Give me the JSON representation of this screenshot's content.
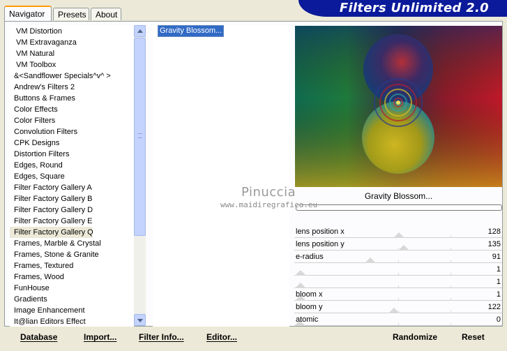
{
  "tabs": [
    "Navigator",
    "Presets",
    "About"
  ],
  "app_title": "Filters Unlimited 2.0",
  "categories": [
    {
      "label": "VM Distortion",
      "indent": true
    },
    {
      "label": "VM Extravaganza",
      "indent": true
    },
    {
      "label": "VM Natural",
      "indent": true
    },
    {
      "label": "VM Toolbox",
      "indent": true
    },
    {
      "label": "&<Sandflower Specials^v^ >",
      "indent": false
    },
    {
      "label": "Andrew's Filters 2",
      "indent": false
    },
    {
      "label": "Buttons & Frames",
      "indent": false
    },
    {
      "label": "Color Effects",
      "indent": false
    },
    {
      "label": "Color Filters",
      "indent": false
    },
    {
      "label": "Convolution Filters",
      "indent": false
    },
    {
      "label": "CPK Designs",
      "indent": false
    },
    {
      "label": "Distortion Filters",
      "indent": false
    },
    {
      "label": "Edges, Round",
      "indent": false
    },
    {
      "label": "Edges, Square",
      "indent": false
    },
    {
      "label": "Filter Factory Gallery A",
      "indent": false
    },
    {
      "label": "Filter Factory Gallery B",
      "indent": false
    },
    {
      "label": "Filter Factory Gallery D",
      "indent": false
    },
    {
      "label": "Filter Factory Gallery E",
      "indent": false
    },
    {
      "label": "Filter Factory Gallery Q",
      "indent": false,
      "selected": true
    },
    {
      "label": "Frames, Marble & Crystal",
      "indent": false
    },
    {
      "label": "Frames, Stone & Granite",
      "indent": false
    },
    {
      "label": "Frames, Textured",
      "indent": false
    },
    {
      "label": "Frames, Wood",
      "indent": false
    },
    {
      "label": "FunHouse",
      "indent": false
    },
    {
      "label": "Gradients",
      "indent": false
    },
    {
      "label": "Image Enhancement",
      "indent": false
    },
    {
      "label": "It@lian Editors Effect",
      "indent": false
    }
  ],
  "filters": [
    "Gravity Blossom..."
  ],
  "preview_name": "Gravity Blossom...",
  "sliders": [
    {
      "label": "lens position x",
      "value": "128",
      "level": 0.502
    },
    {
      "label": "lens position y",
      "value": "135",
      "level": 0.529
    },
    {
      "label": "e-radius",
      "value": "91",
      "level": 0.357
    },
    {
      "label": "",
      "value": "1",
      "level": 0.004
    },
    {
      "label": "",
      "value": "1",
      "level": 0.004
    },
    {
      "label": "bloom x",
      "value": "1",
      "level": 0.004
    },
    {
      "label": "bloom y",
      "value": "122",
      "level": 0.478
    },
    {
      "label": "atomic",
      "value": "0",
      "level": 0.0
    }
  ],
  "buttons": {
    "database": "Database",
    "import": "Import...",
    "filter_info": "Filter Info...",
    "editor": "Editor...",
    "randomize": "Randomize",
    "reset": "Reset"
  },
  "watermark": {
    "name": "Pinuccia",
    "url": "www.maidiregrafica.eu"
  },
  "colors": {
    "selection": "#316ac5",
    "banner": "#0a1a9a",
    "tab_accent": "#ff9c00"
  }
}
